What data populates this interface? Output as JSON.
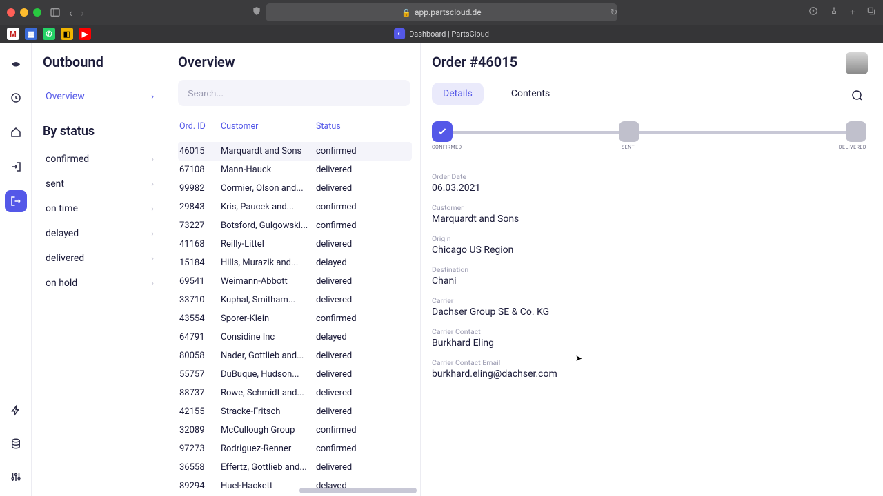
{
  "browser": {
    "url": "app.partscloud.de",
    "tab_title": "Dashboard | PartsCloud"
  },
  "rail": {
    "items": [
      "logo",
      "clock",
      "home",
      "login",
      "send",
      "bolt",
      "db",
      "sliders"
    ],
    "active": "send"
  },
  "sidebar": {
    "title": "Outbound",
    "overview": "Overview",
    "section": "By status",
    "statuses": [
      {
        "label": "confirmed"
      },
      {
        "label": "sent"
      },
      {
        "label": "on time"
      },
      {
        "label": "delayed"
      },
      {
        "label": "delivered"
      },
      {
        "label": "on hold"
      }
    ],
    "active": "Overview"
  },
  "center": {
    "title": "Overview",
    "search_placeholder": "Search...",
    "columns": {
      "id": "Ord. ID",
      "customer": "Customer",
      "status": "Status"
    },
    "rows": [
      {
        "id": "46015",
        "customer": "Marquardt and Sons",
        "status": "confirmed",
        "selected": true
      },
      {
        "id": "67108",
        "customer": "Mann-Hauck",
        "status": "delivered"
      },
      {
        "id": "99982",
        "customer": "Cormier, Olson and...",
        "status": "delivered"
      },
      {
        "id": "29843",
        "customer": "Kris, Paucek and...",
        "status": "confirmed"
      },
      {
        "id": "73227",
        "customer": "Botsford, Gulgowski...",
        "status": "confirmed"
      },
      {
        "id": "41168",
        "customer": "Reilly-Littel",
        "status": "delivered"
      },
      {
        "id": "15184",
        "customer": "Hills, Murazik and...",
        "status": "delayed"
      },
      {
        "id": "69541",
        "customer": "Weimann-Abbott",
        "status": "delivered"
      },
      {
        "id": "33710",
        "customer": "Kuphal, Smitham...",
        "status": "delivered"
      },
      {
        "id": "43554",
        "customer": "Sporer-Klein",
        "status": "confirmed"
      },
      {
        "id": "64791",
        "customer": "Considine Inc",
        "status": "delayed"
      },
      {
        "id": "80058",
        "customer": "Nader, Gottlieb and...",
        "status": "delivered"
      },
      {
        "id": "55757",
        "customer": "DuBuque, Hudson...",
        "status": "delivered"
      },
      {
        "id": "88737",
        "customer": "Rowe, Schmidt and...",
        "status": "delivered"
      },
      {
        "id": "42155",
        "customer": "Stracke-Fritsch",
        "status": "delivered"
      },
      {
        "id": "32089",
        "customer": "McCullough Group",
        "status": "confirmed"
      },
      {
        "id": "97273",
        "customer": "Rodriguez-Renner",
        "status": "confirmed"
      },
      {
        "id": "36558",
        "customer": "Effertz, Gottlieb and...",
        "status": "delivered"
      },
      {
        "id": "89294",
        "customer": "Huel-Hackett",
        "status": "delayed"
      }
    ]
  },
  "detail": {
    "title": "Order #46015",
    "tabs": {
      "details": "Details",
      "contents": "Contents"
    },
    "active_tab": "Details",
    "progress": {
      "steps": [
        "CONFIRMED",
        "SENT",
        "DELIVERED"
      ],
      "done": 0
    },
    "fields": [
      {
        "label": "Order Date",
        "value": "06.03.2021"
      },
      {
        "label": "Customer",
        "value": "Marquardt and Sons"
      },
      {
        "label": "Origin",
        "value": "Chicago US Region"
      },
      {
        "label": "Destination",
        "value": "Chani"
      },
      {
        "label": "Carrier",
        "value": "Dachser Group SE & Co. KG"
      },
      {
        "label": "Carrier Contact",
        "value": "Burkhard Eling"
      },
      {
        "label": "Carrier Contact Email",
        "value": "burkhard.eling@dachser.com"
      }
    ]
  }
}
